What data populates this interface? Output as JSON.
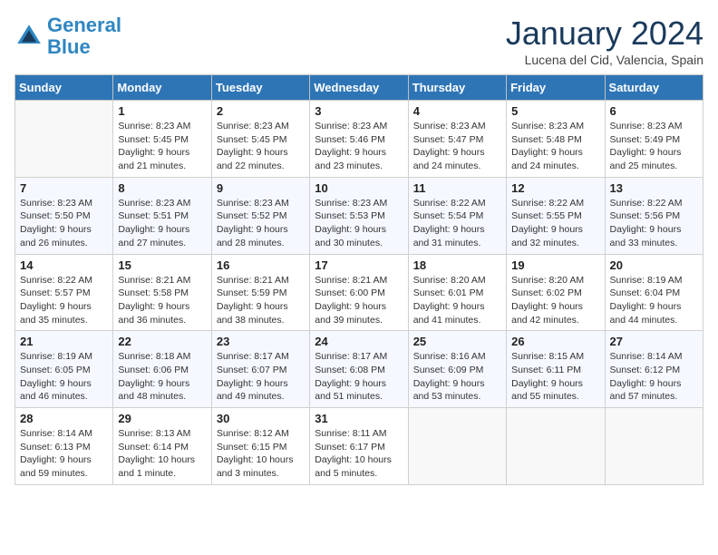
{
  "header": {
    "logo_line1": "General",
    "logo_line2": "Blue",
    "month_title": "January 2024",
    "location": "Lucena del Cid, Valencia, Spain"
  },
  "weekdays": [
    "Sunday",
    "Monday",
    "Tuesday",
    "Wednesday",
    "Thursday",
    "Friday",
    "Saturday"
  ],
  "weeks": [
    [
      {
        "day": "",
        "sunrise": "",
        "sunset": "",
        "daylight": ""
      },
      {
        "day": "1",
        "sunrise": "Sunrise: 8:23 AM",
        "sunset": "Sunset: 5:45 PM",
        "daylight": "Daylight: 9 hours and 21 minutes."
      },
      {
        "day": "2",
        "sunrise": "Sunrise: 8:23 AM",
        "sunset": "Sunset: 5:45 PM",
        "daylight": "Daylight: 9 hours and 22 minutes."
      },
      {
        "day": "3",
        "sunrise": "Sunrise: 8:23 AM",
        "sunset": "Sunset: 5:46 PM",
        "daylight": "Daylight: 9 hours and 23 minutes."
      },
      {
        "day": "4",
        "sunrise": "Sunrise: 8:23 AM",
        "sunset": "Sunset: 5:47 PM",
        "daylight": "Daylight: 9 hours and 24 minutes."
      },
      {
        "day": "5",
        "sunrise": "Sunrise: 8:23 AM",
        "sunset": "Sunset: 5:48 PM",
        "daylight": "Daylight: 9 hours and 24 minutes."
      },
      {
        "day": "6",
        "sunrise": "Sunrise: 8:23 AM",
        "sunset": "Sunset: 5:49 PM",
        "daylight": "Daylight: 9 hours and 25 minutes."
      }
    ],
    [
      {
        "day": "7",
        "sunrise": "Sunrise: 8:23 AM",
        "sunset": "Sunset: 5:50 PM",
        "daylight": "Daylight: 9 hours and 26 minutes."
      },
      {
        "day": "8",
        "sunrise": "Sunrise: 8:23 AM",
        "sunset": "Sunset: 5:51 PM",
        "daylight": "Daylight: 9 hours and 27 minutes."
      },
      {
        "day": "9",
        "sunrise": "Sunrise: 8:23 AM",
        "sunset": "Sunset: 5:52 PM",
        "daylight": "Daylight: 9 hours and 28 minutes."
      },
      {
        "day": "10",
        "sunrise": "Sunrise: 8:23 AM",
        "sunset": "Sunset: 5:53 PM",
        "daylight": "Daylight: 9 hours and 30 minutes."
      },
      {
        "day": "11",
        "sunrise": "Sunrise: 8:22 AM",
        "sunset": "Sunset: 5:54 PM",
        "daylight": "Daylight: 9 hours and 31 minutes."
      },
      {
        "day": "12",
        "sunrise": "Sunrise: 8:22 AM",
        "sunset": "Sunset: 5:55 PM",
        "daylight": "Daylight: 9 hours and 32 minutes."
      },
      {
        "day": "13",
        "sunrise": "Sunrise: 8:22 AM",
        "sunset": "Sunset: 5:56 PM",
        "daylight": "Daylight: 9 hours and 33 minutes."
      }
    ],
    [
      {
        "day": "14",
        "sunrise": "Sunrise: 8:22 AM",
        "sunset": "Sunset: 5:57 PM",
        "daylight": "Daylight: 9 hours and 35 minutes."
      },
      {
        "day": "15",
        "sunrise": "Sunrise: 8:21 AM",
        "sunset": "Sunset: 5:58 PM",
        "daylight": "Daylight: 9 hours and 36 minutes."
      },
      {
        "day": "16",
        "sunrise": "Sunrise: 8:21 AM",
        "sunset": "Sunset: 5:59 PM",
        "daylight": "Daylight: 9 hours and 38 minutes."
      },
      {
        "day": "17",
        "sunrise": "Sunrise: 8:21 AM",
        "sunset": "Sunset: 6:00 PM",
        "daylight": "Daylight: 9 hours and 39 minutes."
      },
      {
        "day": "18",
        "sunrise": "Sunrise: 8:20 AM",
        "sunset": "Sunset: 6:01 PM",
        "daylight": "Daylight: 9 hours and 41 minutes."
      },
      {
        "day": "19",
        "sunrise": "Sunrise: 8:20 AM",
        "sunset": "Sunset: 6:02 PM",
        "daylight": "Daylight: 9 hours and 42 minutes."
      },
      {
        "day": "20",
        "sunrise": "Sunrise: 8:19 AM",
        "sunset": "Sunset: 6:04 PM",
        "daylight": "Daylight: 9 hours and 44 minutes."
      }
    ],
    [
      {
        "day": "21",
        "sunrise": "Sunrise: 8:19 AM",
        "sunset": "Sunset: 6:05 PM",
        "daylight": "Daylight: 9 hours and 46 minutes."
      },
      {
        "day": "22",
        "sunrise": "Sunrise: 8:18 AM",
        "sunset": "Sunset: 6:06 PM",
        "daylight": "Daylight: 9 hours and 48 minutes."
      },
      {
        "day": "23",
        "sunrise": "Sunrise: 8:17 AM",
        "sunset": "Sunset: 6:07 PM",
        "daylight": "Daylight: 9 hours and 49 minutes."
      },
      {
        "day": "24",
        "sunrise": "Sunrise: 8:17 AM",
        "sunset": "Sunset: 6:08 PM",
        "daylight": "Daylight: 9 hours and 51 minutes."
      },
      {
        "day": "25",
        "sunrise": "Sunrise: 8:16 AM",
        "sunset": "Sunset: 6:09 PM",
        "daylight": "Daylight: 9 hours and 53 minutes."
      },
      {
        "day": "26",
        "sunrise": "Sunrise: 8:15 AM",
        "sunset": "Sunset: 6:11 PM",
        "daylight": "Daylight: 9 hours and 55 minutes."
      },
      {
        "day": "27",
        "sunrise": "Sunrise: 8:14 AM",
        "sunset": "Sunset: 6:12 PM",
        "daylight": "Daylight: 9 hours and 57 minutes."
      }
    ],
    [
      {
        "day": "28",
        "sunrise": "Sunrise: 8:14 AM",
        "sunset": "Sunset: 6:13 PM",
        "daylight": "Daylight: 9 hours and 59 minutes."
      },
      {
        "day": "29",
        "sunrise": "Sunrise: 8:13 AM",
        "sunset": "Sunset: 6:14 PM",
        "daylight": "Daylight: 10 hours and 1 minute."
      },
      {
        "day": "30",
        "sunrise": "Sunrise: 8:12 AM",
        "sunset": "Sunset: 6:15 PM",
        "daylight": "Daylight: 10 hours and 3 minutes."
      },
      {
        "day": "31",
        "sunrise": "Sunrise: 8:11 AM",
        "sunset": "Sunset: 6:17 PM",
        "daylight": "Daylight: 10 hours and 5 minutes."
      },
      {
        "day": "",
        "sunrise": "",
        "sunset": "",
        "daylight": ""
      },
      {
        "day": "",
        "sunrise": "",
        "sunset": "",
        "daylight": ""
      },
      {
        "day": "",
        "sunrise": "",
        "sunset": "",
        "daylight": ""
      }
    ]
  ]
}
